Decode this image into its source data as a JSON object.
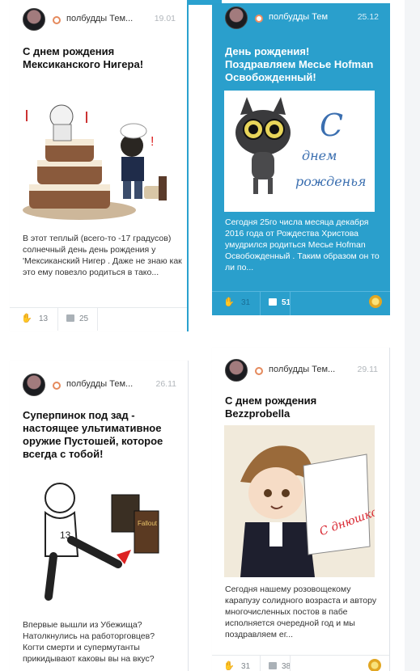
{
  "cards": [
    {
      "user": "полбудды Тем...",
      "date": "19.01",
      "title": "С днем рождения Мексиканского Нигера!",
      "excerpt": "В этот теплый (всего-то -17 градусов) солнечный день день рождения у 'Мексиканский Нигер . Даже не знаю как это ему повезло родиться в тако...",
      "likes": "13",
      "comments": "25"
    },
    {
      "user": "полбудды Тем",
      "date": "25.12",
      "title": "День рождения! Поздравляем Месье Hofman Освобожденный!",
      "excerpt": "Сегодня 25го числа месяца декабря 2016 года от Рождества Христова умудрился родиться Месье Hofman Освобожденный . Таким образом он то ли по...",
      "likes": "31",
      "comments": "51",
      "image_text": "С днем рожденья"
    },
    {
      "user": "полбудды Тем...",
      "date": "26.11",
      "title": "Суперпинок под зад - настоящее ультимативное оружие Пустошей, которое всегда с тобой!",
      "excerpt": "Впервые вышли из Убежища? Натолкнулись на работорговцев? Когти смерти и супермутанты прикидывают каковы вы на вкус?",
      "image_text": "Fallout"
    },
    {
      "user": "полбудды Тем...",
      "date": "29.11",
      "title": "С днем рождения Bezzprobella",
      "excerpt": "Сегодня нашему розовощекому карапузу солидного возраста и автору многочисленных постов в пабе исполняется очередной год и мы поздравляем ег...",
      "likes": "31",
      "comments": "38",
      "image_text": "С днюшкой!"
    }
  ],
  "colors": {
    "accent_blue": "#2aa1cf",
    "card_blue": "#2a9fcc",
    "user_icon": "#e58a5d"
  },
  "icons": {
    "like": "hand-icon",
    "comment": "comment-icon",
    "badge": "medal-icon"
  }
}
